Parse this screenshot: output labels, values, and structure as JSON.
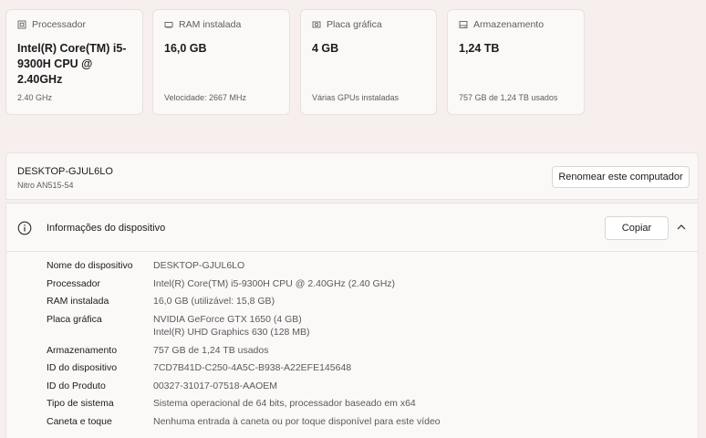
{
  "cards": [
    {
      "label": "Processador",
      "value": "Intel(R) Core(TM) i5-9300H CPU @ 2.40GHz",
      "sub": "2.40 GHz",
      "icon": "processor-icon"
    },
    {
      "label": "RAM instalada",
      "value": "16,0 GB",
      "sub": "Velocidade: 2667 MHz",
      "icon": "ram-icon"
    },
    {
      "label": "Placa gráfica",
      "value": "4 GB",
      "sub": "Várias GPUs instaladas",
      "icon": "gpu-icon"
    },
    {
      "label": "Armazenamento",
      "value": "1,24 TB",
      "sub": "757 GB de 1,24 TB usados",
      "icon": "storage-icon"
    }
  ],
  "device": {
    "name": "DESKTOP-GJUL6LO",
    "model": "Nitro AN515-54",
    "rename_label": "Renomear este computador"
  },
  "info": {
    "title": "Informações do dispositivo",
    "copy_label": "Copiar",
    "icon": "info-icon",
    "rows": [
      {
        "key": "Nome do dispositivo",
        "value": "DESKTOP-GJUL6LO"
      },
      {
        "key": "Processador",
        "value": "Intel(R) Core(TM) i5-9300H CPU @ 2.40GHz (2.40 GHz)"
      },
      {
        "key": "RAM instalada",
        "value": "16,0 GB (utilizável: 15,8 GB)"
      },
      {
        "key": "Placa gráfica",
        "value": "NVIDIA GeForce GTX 1650 (4 GB)",
        "value2": "Intel(R) UHD Graphics 630 (128 MB)"
      },
      {
        "key": "Armazenamento",
        "value": "757 GB de 1,24 TB usados"
      },
      {
        "key": "ID do dispositivo",
        "value": "7CD7B41D-C250-4A5C-B938-A22EFE145648"
      },
      {
        "key": "ID do Produto",
        "value": "00327-31017-07518-AAOEM"
      },
      {
        "key": "Tipo de sistema",
        "value": "Sistema operacional de 64 bits, processador baseado em x64"
      },
      {
        "key": "Caneta e toque",
        "value": "Nenhuma entrada à caneta ou por toque disponível para este vídeo"
      }
    ]
  }
}
